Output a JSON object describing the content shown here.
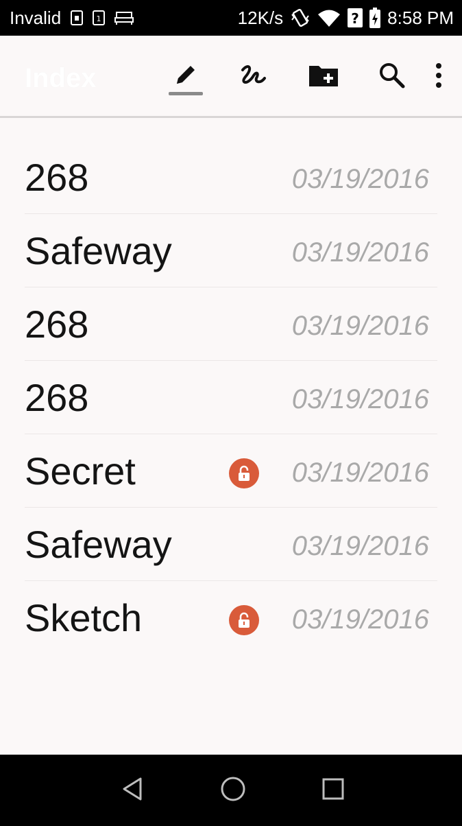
{
  "status_bar": {
    "carrier": "Invalid",
    "speed": "12K/s",
    "time": "8:58 PM",
    "icons": [
      "sim-icon",
      "sim-icon",
      "bed-icon",
      "vibrate-icon",
      "wifi-icon",
      "signal-unknown-icon",
      "battery-charging-icon"
    ]
  },
  "app_bar": {
    "title": "Index",
    "actions": [
      "pencil-icon",
      "handwriting-icon",
      "new-folder-icon",
      "search-icon",
      "more-vert-icon"
    ]
  },
  "notes": [
    {
      "title": "268",
      "date": "03/19/2016",
      "locked": false
    },
    {
      "title": "Safeway",
      "date": "03/19/2016",
      "locked": false
    },
    {
      "title": "268",
      "date": "03/19/2016",
      "locked": false
    },
    {
      "title": "268",
      "date": "03/19/2016",
      "locked": false
    },
    {
      "title": "Secret",
      "date": "03/19/2016",
      "locked": true
    },
    {
      "title": "Safeway",
      "date": "03/19/2016",
      "locked": false
    },
    {
      "title": "Sketch",
      "date": "03/19/2016",
      "locked": true
    }
  ],
  "colors": {
    "lock_badge": "#d95b3a",
    "date_text": "#a9a9a9",
    "background": "#fbf8f8"
  },
  "nav_bar": {
    "buttons": [
      "back-icon",
      "home-icon",
      "recents-icon"
    ]
  }
}
